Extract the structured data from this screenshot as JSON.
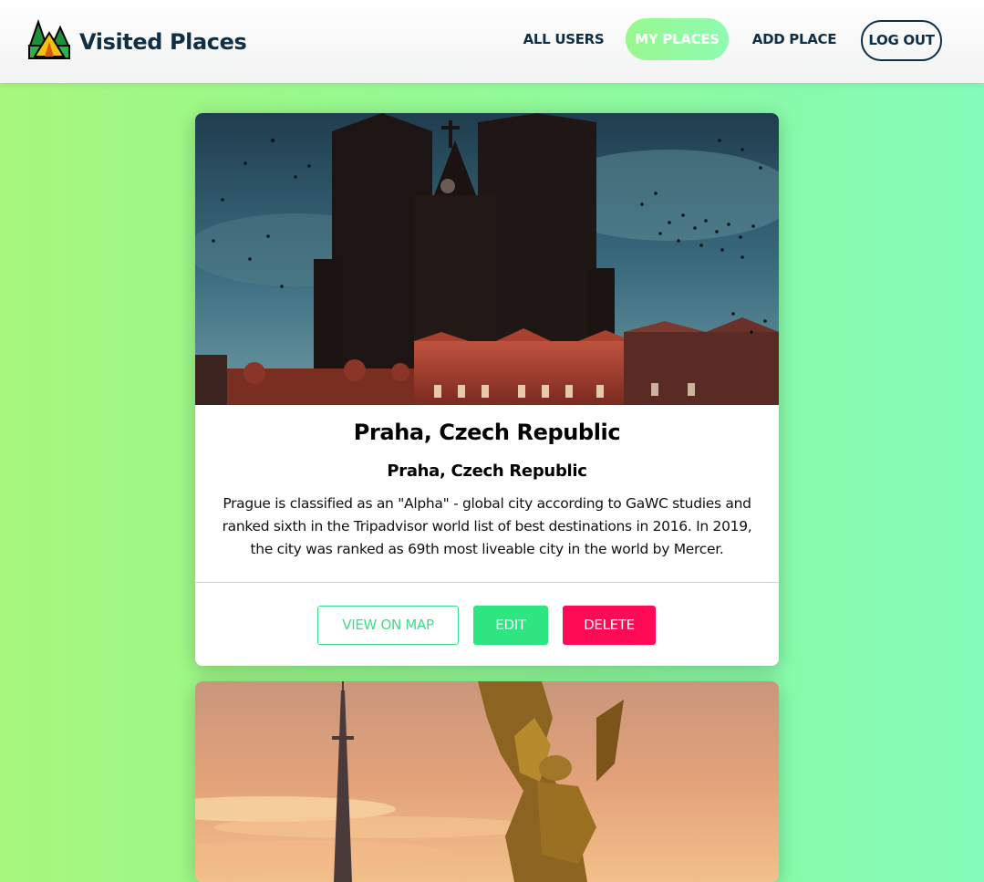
{
  "header": {
    "logo_icon": "camping-tent-icon",
    "brand": "Visited Places",
    "nav": {
      "all_users": "ALL USERS",
      "my_places": "MY PLACES",
      "add_place": "ADD PLACE",
      "logout": "LOG OUT"
    }
  },
  "places": [
    {
      "title": "Praha, Czech Republic",
      "address": "Praha, Czech Republic",
      "description": "Prague is classified as an \"Alpha\" - global city according to GaWC studies and ranked sixth in the Tripadvisor world list of best destinations in 2016. In 2019, the city was ranked as 69th most liveable city in the world by Mercer.",
      "actions": {
        "view_on_map": "VIEW ON MAP",
        "edit": "EDIT",
        "delete": "DELETE"
      }
    }
  ],
  "colors": {
    "primary_text": "#0f2f47",
    "active_nav": "#98f88f",
    "edit": "#2ee582",
    "delete": "#ff0a55",
    "map_outline": "#3bde86",
    "background_start": "#a6f77c",
    "background_end": "#84fbb9"
  }
}
